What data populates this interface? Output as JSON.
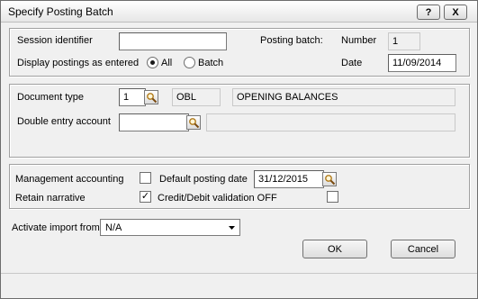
{
  "window": {
    "title": "Specify Posting Batch",
    "help_label": "?",
    "close_label": "X"
  },
  "session": {
    "identifier_label": "Session identifier",
    "identifier_value": "",
    "display_label": "Display postings as entered",
    "option_all": "All",
    "option_batch": "Batch",
    "selected": "All",
    "posting_batch_label": "Posting batch:",
    "number_label": "Number",
    "number_value": "1",
    "date_label": "Date",
    "date_value": "11/09/2014"
  },
  "document": {
    "type_label": "Document type",
    "type_value": "1",
    "type_code": "OBL",
    "type_description": "OPENING BALANCES",
    "double_entry_label": "Double entry account",
    "double_entry_value": "",
    "double_entry_description": ""
  },
  "options": {
    "management_label": "Management accounting",
    "management_checked": false,
    "default_date_label": "Default posting date",
    "default_date_value": "31/12/2015",
    "retain_label": "Retain narrative",
    "retain_checked": true,
    "validation_label": "Credit/Debit validation OFF",
    "validation_checked": false,
    "check_mark": "✓"
  },
  "import": {
    "label": "Activate import from",
    "value": "N/A"
  },
  "buttons": {
    "ok": "OK",
    "cancel": "Cancel"
  }
}
